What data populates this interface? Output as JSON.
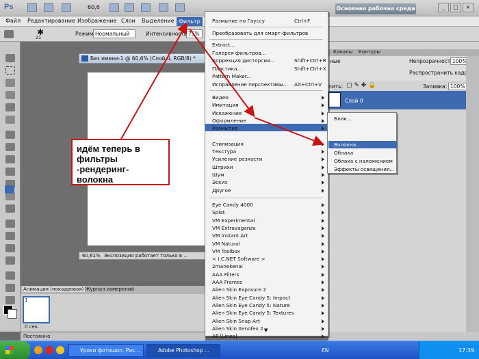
{
  "appbar": {
    "logo": "Ps",
    "zoom": "60,6",
    "workspace": "Основная рабочая среда"
  },
  "menubar": [
    "Файл",
    "Редактирование",
    "Изображение",
    "Слои",
    "Выделение",
    "Фильтр"
  ],
  "options": {
    "mode_label": "Режим:",
    "mode_value": "Нормальный",
    "intensity_label": "Интенсивность:",
    "intensity_value": "75%",
    "brush_size": "21"
  },
  "document": {
    "tab_title": "Без имени-1 @ 60,6% (Слой 0, RGB/8) *",
    "status_zoom": "60,61%",
    "status_text": "Экспозиция работает только в ..."
  },
  "animation": {
    "tab_animation": "Анимация (покадровая)",
    "tab_journal": "Журнал измерений",
    "frame_number": "1",
    "frame_time": "0 сек.",
    "loop": "Постоянно"
  },
  "right_panel": {
    "tab_channels": "Каналы",
    "tab_contours": "Контуры",
    "opacity_label": "Непрозрачность:",
    "opacity_value": "100%",
    "spread_label": "Распространить кадр 1",
    "lock_label": "пить:",
    "fill_label": "Заливка:",
    "fill_value": "100%",
    "layer_name": "Слой 0",
    "blend_partial": "ные"
  },
  "filter_menu": {
    "items_top": [
      {
        "label": "Размытие по Гауссу",
        "shortcut": "Ctrl+F"
      },
      {
        "label": "Преобразовать для смарт-фильтров",
        "shortcut": ""
      }
    ],
    "items_group2": [
      {
        "label": "Extract...",
        "shortcut": ""
      },
      {
        "label": "Галерея фильтров...",
        "shortcut": ""
      },
      {
        "label": "Коррекция дисторсии...",
        "shortcut": "Shift+Ctrl+R"
      },
      {
        "label": "Пластика...",
        "shortcut": "Shift+Ctrl+X"
      },
      {
        "label": "Pattern Maker...",
        "shortcut": ""
      },
      {
        "label": "Исправление перспективы...",
        "shortcut": "Alt+Ctrl+V"
      }
    ],
    "items_group3": [
      "Видео",
      "Имитация",
      "Искажение",
      "Оформление",
      "Размытие",
      "Рендеринг",
      "Стилизация",
      "Текстура",
      "Усиление резкости",
      "Штрихи",
      "Шум",
      "Эскиз",
      "Другое"
    ],
    "items_group4": [
      "Eye Candy 4000",
      "Splat",
      "VM Experimental",
      "VM Extravaganza",
      "VM Instant Art",
      "VM Natural",
      "VM Toolbox",
      "< I.C.NET Software >",
      "2manekenai",
      "AAA Filters",
      "AAA Frames",
      "Alien Skin Exposure 2",
      "Alien Skin Eye Candy 5: Impact",
      "Alien Skin Eye Candy 5: Nature",
      "Alien Skin Eye Candy 5: Textures",
      "Alien Skin Snap Art",
      "Alien Skin Xenofex 2",
      "AP [Lines]",
      "AP 01 [Innovations]"
    ]
  },
  "render_submenu": [
    "Блик...",
    "Волокна...",
    "Облака",
    "Облака с наложением",
    "Эффекты освещения..."
  ],
  "annotation": {
    "line1": "идём теперь в",
    "line2": "фильтры",
    "line3": "-рендеринг-волокна"
  },
  "taskbar": {
    "item1": "Уроки фотошоп. Рис...",
    "item2": "Adobe Photoshop ...",
    "lang": "EN",
    "time": "17:39"
  },
  "colors": {
    "highlight": "#3d6ab1",
    "annotation_red": "#c81414"
  }
}
